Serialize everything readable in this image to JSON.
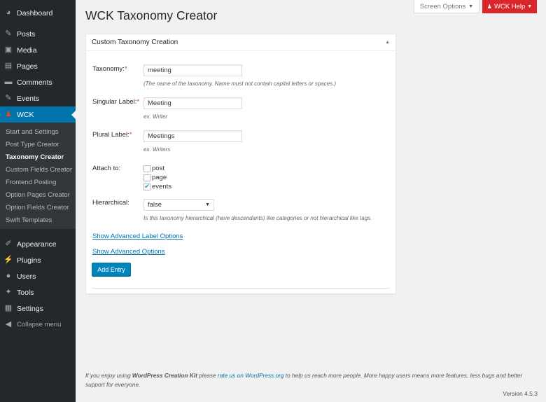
{
  "sidebar": {
    "items": [
      {
        "label": "Dashboard",
        "icon": "dashboard-icon"
      },
      {
        "label": "Posts",
        "icon": "pin-icon"
      },
      {
        "label": "Media",
        "icon": "media-icon"
      },
      {
        "label": "Pages",
        "icon": "page-icon"
      },
      {
        "label": "Comments",
        "icon": "comment-icon"
      },
      {
        "label": "Events",
        "icon": "pin-icon"
      },
      {
        "label": "WCK",
        "icon": "wck-icon"
      }
    ],
    "submenu": [
      "Start and Settings",
      "Post Type Creator",
      "Taxonomy Creator",
      "Custom Fields Creator",
      "Frontend Posting",
      "Option Pages Creator",
      "Option Fields Creator",
      "Swift Templates"
    ],
    "lower_items": [
      {
        "label": "Appearance",
        "icon": "brush-icon"
      },
      {
        "label": "Plugins",
        "icon": "plugin-icon"
      },
      {
        "label": "Users",
        "icon": "user-icon"
      },
      {
        "label": "Tools",
        "icon": "wrench-icon"
      },
      {
        "label": "Settings",
        "icon": "settings-icon"
      }
    ],
    "collapse_label": "Collapse menu"
  },
  "topbar": {
    "screen_options": "Screen Options",
    "help": "WCK Help"
  },
  "page": {
    "title": "WCK Taxonomy Creator"
  },
  "panel": {
    "title": "Custom Taxonomy Creation",
    "taxonomy": {
      "label": "Taxonomy:",
      "required": "*",
      "value": "meeting",
      "hint": "(The name of the taxonomy. Name must not contain capital letters or spaces.)"
    },
    "singular": {
      "label": "Singular Label:",
      "required": "*",
      "value": "Meeting",
      "hint": "ex. Writer"
    },
    "plural": {
      "label": "Plural Label:",
      "required": "*",
      "value": "Meetings",
      "hint": "ex. Writers"
    },
    "attach": {
      "label": "Attach to:",
      "options": [
        {
          "label": "post",
          "checked": false
        },
        {
          "label": "page",
          "checked": false
        },
        {
          "label": "events",
          "checked": true
        }
      ]
    },
    "hierarchical": {
      "label": "Hierarchical:",
      "value": "false",
      "hint": "Is this taxonomy hierarchical (have descendants) like categories or not hierarchical like tags."
    },
    "adv_label_link": "Show Advanced Label Options",
    "adv_link": "Show Advanced Options",
    "submit": "Add Entry"
  },
  "footer": {
    "text_1": "If you enjoy using ",
    "brand": "WordPress Creation Kit",
    "text_2": " please ",
    "rate_link": "rate us on WordPress.org",
    "text_3": " to help us reach more people. More happy users means more features, less bugs and better support for everyone.",
    "version": "Version 4.5.3"
  }
}
